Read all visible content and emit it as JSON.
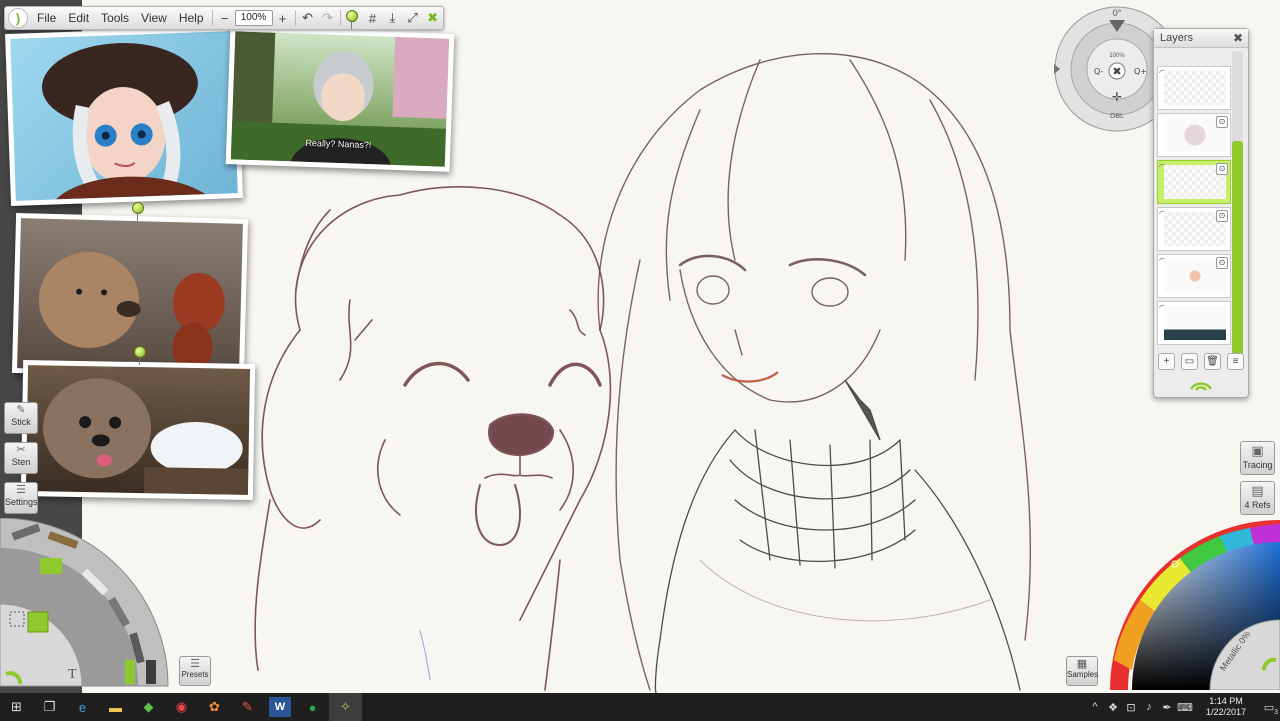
{
  "menu": {
    "items": [
      "File",
      "Edit",
      "Tools",
      "View",
      "Help"
    ],
    "zoom": "100%"
  },
  "references": {
    "photo2_caption": "Really? Nanas?!"
  },
  "left_buttons": {
    "sticker": "Stick",
    "stencil": "Sten",
    "settings": "Settings",
    "presets": "Presets"
  },
  "navigator": {
    "angle": "0°",
    "zoom": "100%",
    "flip": "OBL"
  },
  "layers": {
    "title": "Layers",
    "close": "✖"
  },
  "right_buttons": {
    "tracing": "Tracing",
    "refs": "4 Refs",
    "samples": "Samples"
  },
  "color": {
    "metallic": "Metallic 0%",
    "accent": "#8fc92d"
  },
  "taskbar": {
    "time": "1:14 PM",
    "date": "1/22/2017",
    "notif_count": "3"
  },
  "icons": [
    "windows-icon",
    "task-view-icon",
    "edge-icon",
    "file-explorer-icon",
    "photos-icon",
    "chrome-icon",
    "paint-icon",
    "pencil-app-icon",
    "word-icon",
    "hangouts-icon",
    "artrage-icon"
  ]
}
